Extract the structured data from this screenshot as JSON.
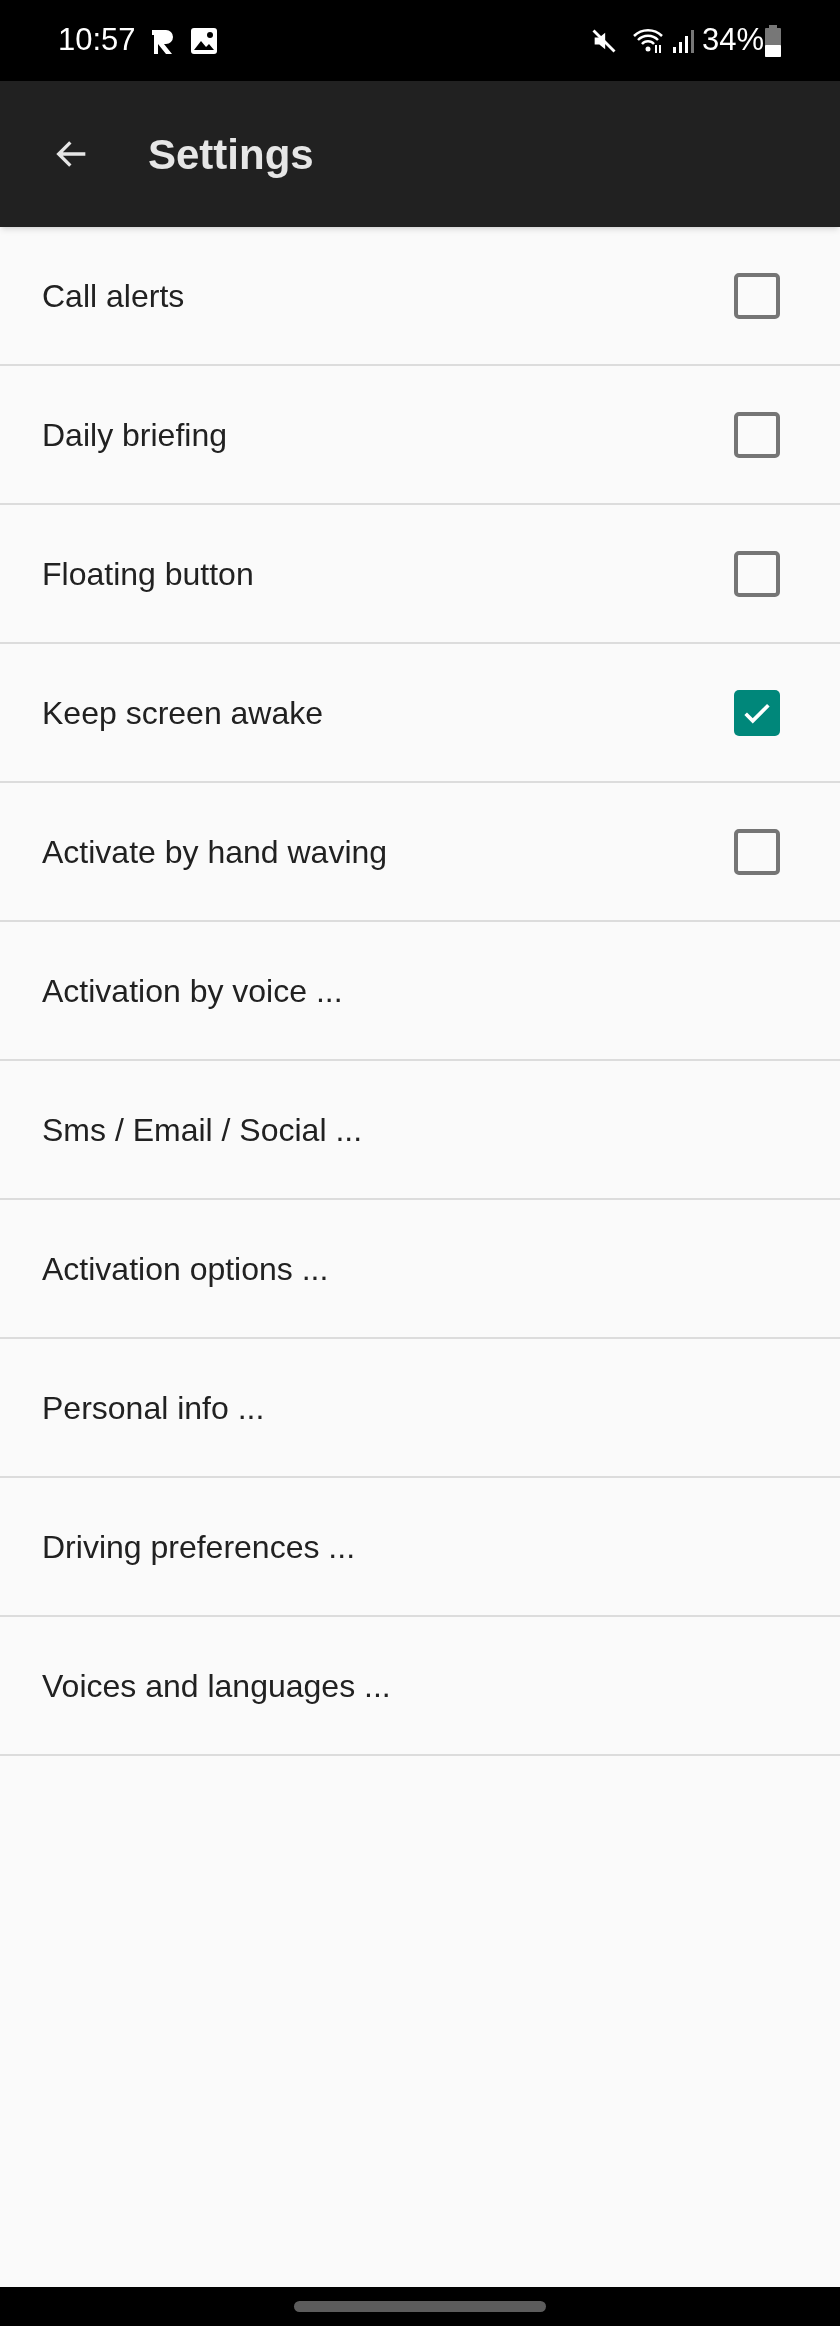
{
  "status_bar": {
    "time": "10:57",
    "battery": "34%"
  },
  "app_bar": {
    "title": "Settings"
  },
  "items": [
    {
      "kind": "checkbox",
      "label": "Call alerts",
      "checked": false
    },
    {
      "kind": "checkbox",
      "label": "Daily briefing",
      "checked": false
    },
    {
      "kind": "checkbox",
      "label": "Floating button",
      "checked": false
    },
    {
      "kind": "checkbox",
      "label": "Keep screen awake",
      "checked": true
    },
    {
      "kind": "checkbox",
      "label": "Activate by hand waving",
      "checked": false
    },
    {
      "kind": "link",
      "label": "Activation by voice ..."
    },
    {
      "kind": "link",
      "label": "Sms / Email / Social ..."
    },
    {
      "kind": "link",
      "label": "Activation options ..."
    },
    {
      "kind": "link",
      "label": "Personal info ..."
    },
    {
      "kind": "link",
      "label": "Driving preferences ..."
    },
    {
      "kind": "link",
      "label": "Voices and languages ..."
    }
  ]
}
